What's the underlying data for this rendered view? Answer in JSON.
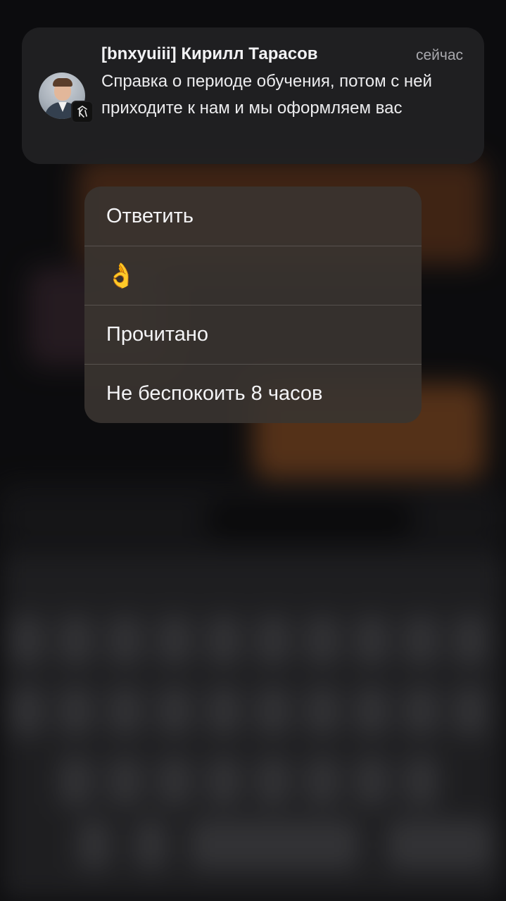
{
  "notification": {
    "sender": "[bnxyuiii] Кирилл Тарасов",
    "time": "сейчас",
    "message": "Справка о периоде обучения, потом с ней приходите к нам и мы оформляем вас",
    "avatar_icon": "user-photo",
    "app_icon": "app-logo-icon"
  },
  "menu": {
    "items": [
      {
        "label": "Ответить"
      },
      {
        "label": "👌"
      },
      {
        "label": "Прочитано"
      },
      {
        "label": "Не беспокоить 8 часов"
      }
    ]
  }
}
